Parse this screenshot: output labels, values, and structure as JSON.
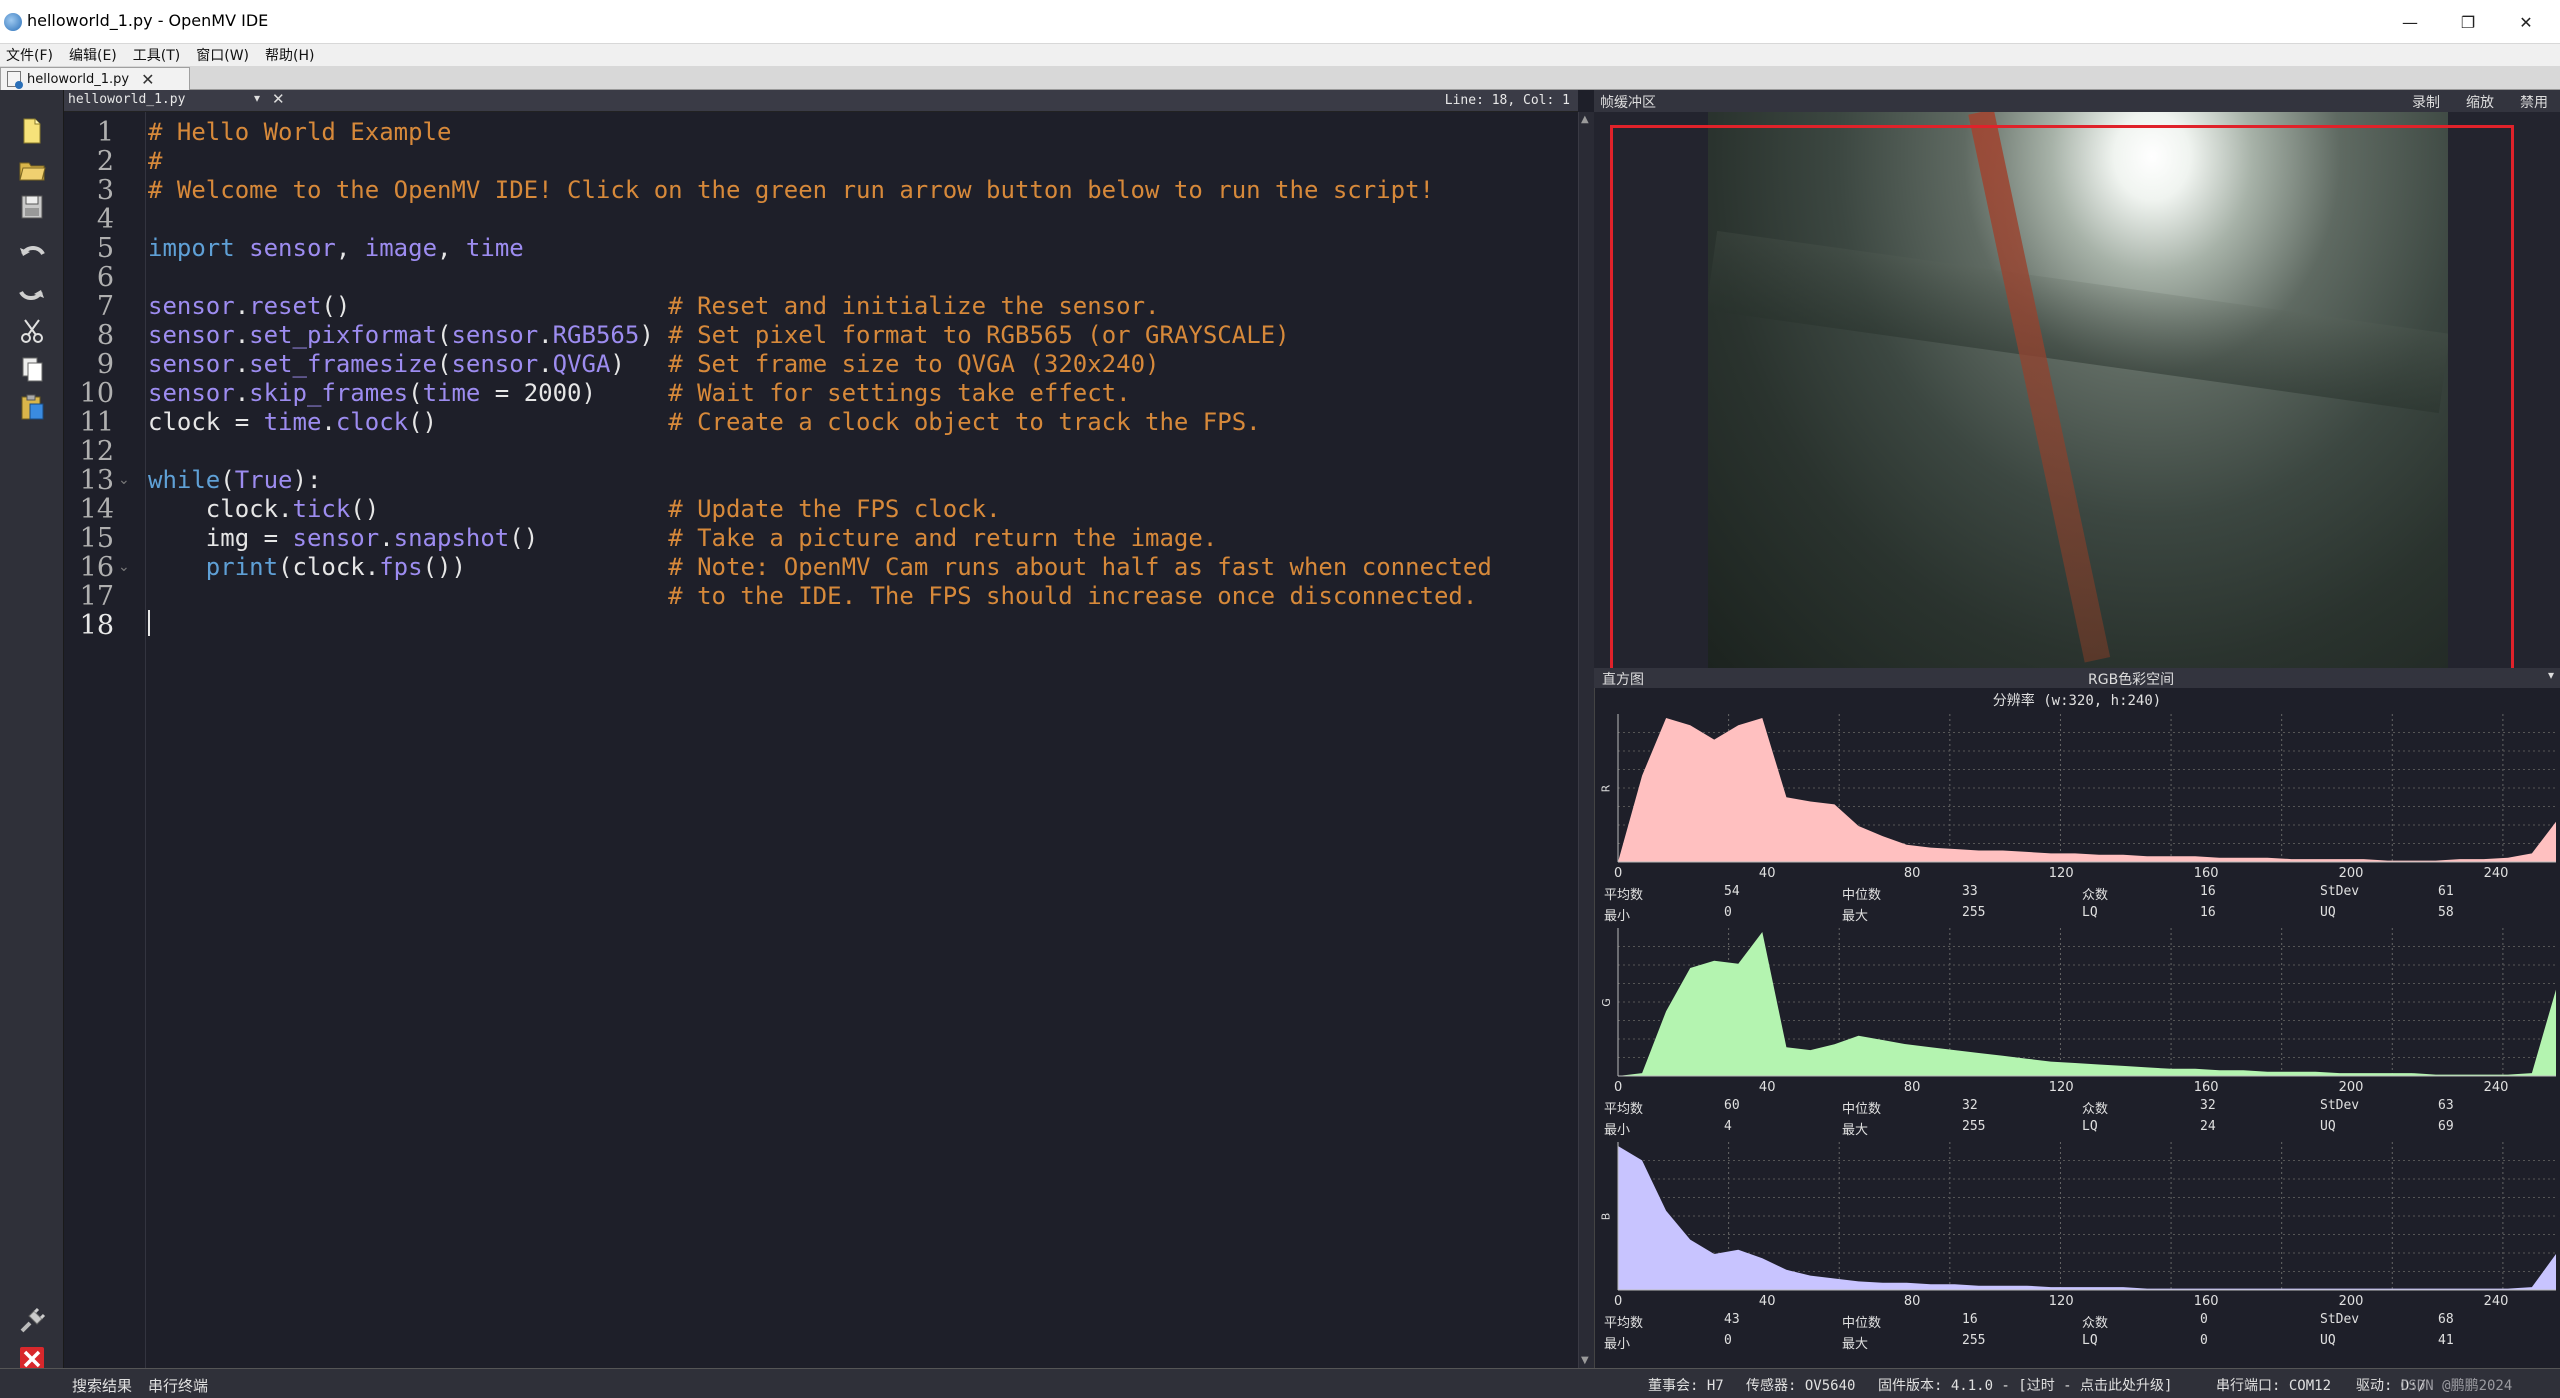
{
  "window": {
    "title": "helloworld_1.py - OpenMV IDE"
  },
  "menu": [
    {
      "label": "文件(F)"
    },
    {
      "label": "编辑(E)"
    },
    {
      "label": "工具(T)"
    },
    {
      "label": "窗口(W)"
    },
    {
      "label": "帮助(H)"
    }
  ],
  "tab": {
    "label": "helloworld_1.py"
  },
  "editor": {
    "file_label": "helloworld_1.py",
    "position": "Line: 18, Col: 1",
    "line_numbers": [
      "1",
      "2",
      "3",
      "4",
      "5",
      "6",
      "7",
      "8",
      "9",
      "10",
      "11",
      "12",
      "13",
      "14",
      "15",
      "16",
      "17",
      "18"
    ],
    "lines": [
      "# Hello World Example",
      "#",
      "# Welcome to the OpenMV IDE! Click on the green run arrow button below to run the script!",
      "",
      "import sensor, image, time",
      "",
      "sensor.reset()                      # Reset and initialize the sensor.",
      "sensor.set_pixformat(sensor.RGB565) # Set pixel format to RGB565 (or GRAYSCALE)",
      "sensor.set_framesize(sensor.QVGA)   # Set frame size to QVGA (320x240)",
      "sensor.skip_frames(time = 2000)     # Wait for settings take effect.",
      "clock = time.clock()                # Create a clock object to track the FPS.",
      "",
      "while(True):",
      "    clock.tick()                    # Update the FPS clock.",
      "    img = sensor.snapshot()         # Take a picture and return the image.",
      "    print(clock.fps())              # Note: OpenMV Cam runs about half as fast when connected",
      "                                    # to the IDE. The FPS should increase once disconnected.",
      ""
    ]
  },
  "framebuffer": {
    "title": "帧缓冲区",
    "buttons": [
      "录制",
      "缩放",
      "禁用"
    ]
  },
  "histogram": {
    "title": "直方图",
    "colorspace": "RGB色彩空间",
    "resolution": "分辨率 (w:320, h:240)",
    "x_ticks": [
      "0",
      "40",
      "80",
      "120",
      "160",
      "200",
      "240"
    ],
    "channels": [
      {
        "label": "R",
        "color": "#ffc0c0",
        "values": [
          0,
          60,
          100,
          95,
          85,
          95,
          100,
          45,
          42,
          40,
          25,
          18,
          12,
          10,
          9,
          8,
          8,
          7,
          6,
          6,
          5,
          5,
          4,
          4,
          4,
          3,
          3,
          3,
          2,
          2,
          2,
          2,
          1,
          1,
          1,
          2,
          2,
          3,
          6,
          28
        ],
        "stats": {
          "mean_label": "平均数",
          "mean": "54",
          "median_label": "中位数",
          "median": "33",
          "mode_label": "众数",
          "mode": "16",
          "stdev_label": "StDev",
          "stdev": "61",
          "min_label": "最小",
          "min": "0",
          "max_label": "最大",
          "max": "255",
          "lq_label": "LQ",
          "lq": "16",
          "uq_label": "UQ",
          "uq": "58"
        }
      },
      {
        "label": "G",
        "color": "#b4f4b0",
        "values": [
          0,
          2,
          45,
          75,
          80,
          78,
          100,
          20,
          18,
          22,
          28,
          25,
          22,
          20,
          18,
          16,
          14,
          12,
          10,
          9,
          8,
          7,
          6,
          5,
          5,
          4,
          4,
          3,
          3,
          3,
          2,
          2,
          2,
          2,
          1,
          1,
          1,
          1,
          2,
          60
        ],
        "stats": {
          "mean_label": "平均数",
          "mean": "60",
          "median_label": "中位数",
          "median": "32",
          "mode_label": "众数",
          "mode": "32",
          "stdev_label": "StDev",
          "stdev": "63",
          "min_label": "最小",
          "min": "4",
          "max_label": "最大",
          "max": "255",
          "lq_label": "LQ",
          "lq": "24",
          "uq_label": "UQ",
          "uq": "69"
        }
      },
      {
        "label": "B",
        "color": "#c8c4ff",
        "values": [
          100,
          90,
          55,
          35,
          25,
          28,
          22,
          14,
          10,
          8,
          6,
          5,
          5,
          4,
          4,
          3,
          3,
          3,
          2,
          2,
          2,
          2,
          1,
          1,
          1,
          1,
          1,
          1,
          1,
          1,
          1,
          1,
          1,
          1,
          1,
          1,
          1,
          1,
          2,
          25
        ],
        "stats": {
          "mean_label": "平均数",
          "mean": "43",
          "median_label": "中位数",
          "median": "16",
          "mode_label": "众数",
          "mode": "0",
          "stdev_label": "StDev",
          "stdev": "68",
          "min_label": "最小",
          "min": "0",
          "max_label": "最大",
          "max": "255",
          "lq_label": "LQ",
          "lq": "0",
          "uq_label": "UQ",
          "uq": "41"
        }
      }
    ]
  },
  "bottom": {
    "tabs": [
      "搜索结果",
      "串行终端"
    ],
    "status": {
      "board": "董事会: H7",
      "sensor": "传感器: OV5640",
      "firmware": "固件版本: 4.1.0 - [过时 - 点击此处升级]",
      "port": "串行端口: COM12",
      "drive": "驱动: D:/"
    },
    "watermark": "CSDN @鹏鹏2024"
  }
}
